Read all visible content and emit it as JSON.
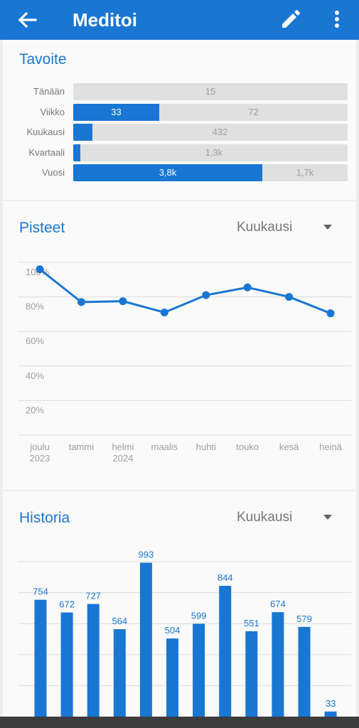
{
  "app_bar": {
    "title": "Meditoi",
    "back_icon": "arrow-left-icon",
    "edit_icon": "pencil-icon",
    "more_icon": "more-vert-icon"
  },
  "colors": {
    "primary": "#1976d2",
    "track": "#e0e0e0",
    "card": "#fafafa",
    "background": "#eeeeee",
    "muted_text": "#757575",
    "grid": "#dddddd"
  },
  "goal": {
    "title": "Tavoite",
    "rows": [
      {
        "label": "Tänään",
        "fraction": 0.0,
        "done_text": "",
        "remaining_text": "15"
      },
      {
        "label": "Viikko",
        "fraction": 0.314,
        "done_text": "33",
        "remaining_text": "72"
      },
      {
        "label": "Kuukausi",
        "fraction": 0.07,
        "done_text": "",
        "remaining_text": "432"
      },
      {
        "label": "Kvartaali",
        "fraction": 0.025,
        "done_text": "",
        "remaining_text": "1,3k"
      },
      {
        "label": "Vuosi",
        "fraction": 0.69,
        "done_text": "3,8k",
        "remaining_text": "1,7k"
      }
    ]
  },
  "points": {
    "title": "Pisteet",
    "period_selected": "Kuukausi",
    "dropdown_icon": "caret-down-icon"
  },
  "history": {
    "title": "Historia",
    "period_selected": "Kuukausi",
    "dropdown_icon": "caret-down-icon"
  },
  "chart_data": [
    {
      "type": "line",
      "title": "Pisteet",
      "categories": [
        "joulu\n2023",
        "tammi",
        "helmi\n2024",
        "maalis",
        "huhti",
        "touko",
        "kesä",
        "heinä"
      ],
      "values": [
        96,
        77,
        77.5,
        71,
        81,
        85.5,
        80,
        70.5
      ],
      "y_ticks": [
        "20%",
        "40%",
        "60%",
        "80%",
        "100%"
      ],
      "ylim": [
        0,
        100
      ],
      "grid": true,
      "color": "#1976d2"
    },
    {
      "type": "bar",
      "title": "Historia",
      "categories": [
        "",
        "",
        "",
        "",
        "",
        "",
        "",
        "",
        "",
        "",
        "",
        ""
      ],
      "values": [
        754,
        672,
        727,
        564,
        993,
        504,
        599,
        844,
        551,
        674,
        579,
        33
      ],
      "labels": [
        "754",
        "672",
        "727",
        "564",
        "993",
        "504",
        "599",
        "844",
        "551",
        "674",
        "579",
        "33"
      ],
      "grid": true,
      "color": "#1976d2"
    }
  ]
}
